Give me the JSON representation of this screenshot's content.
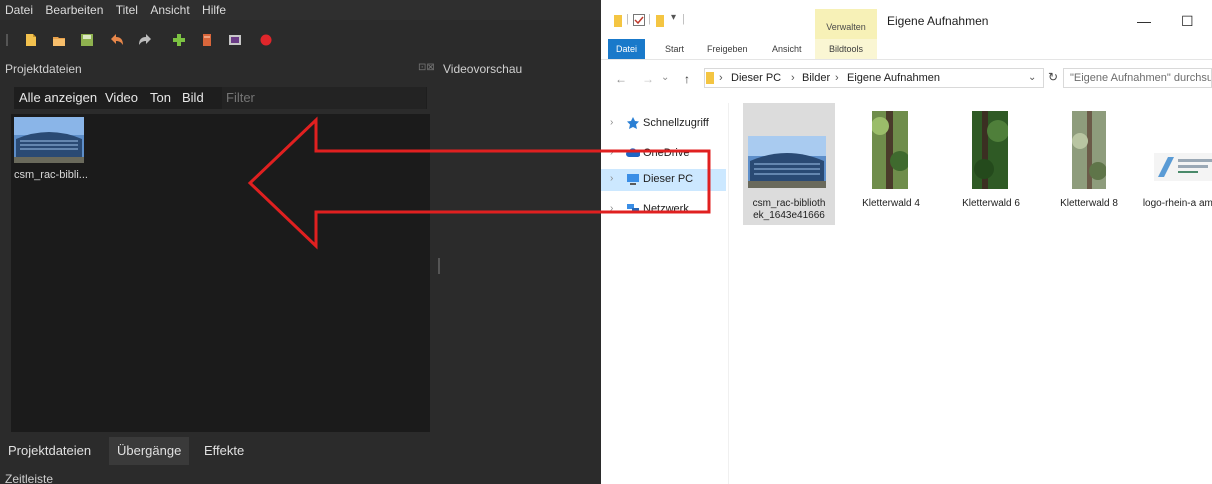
{
  "editor": {
    "menu": [
      "Datei",
      "Bearbeiten",
      "Titel",
      "Ansicht",
      "Hilfe"
    ],
    "project_files_title": "Projektdateien",
    "video_preview_title": "Videovorschau",
    "filter_tabs": [
      "Alle anzeigen",
      "Video",
      "Ton",
      "Bild"
    ],
    "filter_placeholder": "Filter",
    "files": [
      {
        "label": "csm_rac-bibli..."
      }
    ],
    "bottom_tabs": [
      "Projektdateien",
      "Übergänge",
      "Effekte"
    ],
    "timeline_title": "Zeitleiste"
  },
  "explorer": {
    "context_label": "Verwalten",
    "window_title": "Eigene Aufnahmen",
    "window_buttons": {
      "minimize": "—",
      "maximize": "☐"
    },
    "ribbon_tabs": [
      "Datei",
      "Start",
      "Freigeben",
      "Ansicht",
      "Bildtools"
    ],
    "breadcrumb": [
      "Dieser PC",
      "Bilder",
      "Eigene Aufnahmen"
    ],
    "search_placeholder": "\"Eigene Aufnahmen\" durchsuc...",
    "nav_items": [
      "Schnellzugriff",
      "OneDrive",
      "Dieser PC",
      "Netzwerk"
    ],
    "files": [
      {
        "label": "csm_rac-biblioth ek_1643e41666"
      },
      {
        "label": "Kletterwald 4"
      },
      {
        "label": "Kletterwald 6"
      },
      {
        "label": "Kletterwald 8"
      },
      {
        "label": "logo-rhein-a ampus"
      }
    ]
  },
  "colors": {
    "annotation_arrow": "#e02020",
    "ribbon_accent": "#1979ca",
    "context_tab": "#f7f1b7",
    "selection": "#cce8ff"
  }
}
